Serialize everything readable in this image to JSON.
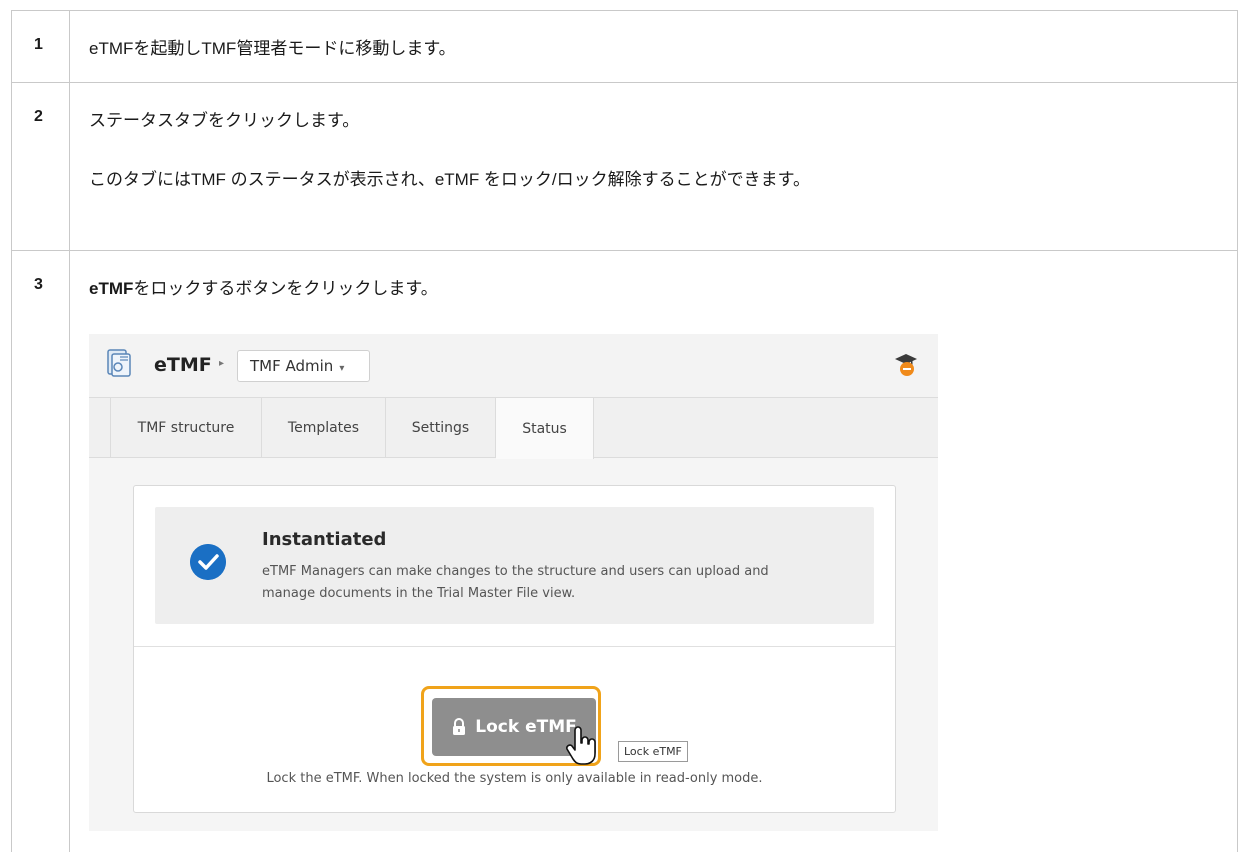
{
  "steps": [
    {
      "num": "1",
      "text": "eTMFを起動しTMF管理者モードに移動します。"
    },
    {
      "num": "2",
      "text": "ステータスタブをクリックします。",
      "note": "このタブにはTMF のステータスが表示され、eTMF をロック/ロック解除することができます。"
    },
    {
      "num": "3",
      "bold": "eTMF",
      "text": "をロックするボタンをクリックします。"
    }
  ],
  "app": {
    "name": "eTMF",
    "mode": "TMF Admin",
    "icon": "document-app-icon",
    "help_icon": "graduation-cap-icon"
  },
  "tabs": [
    {
      "label": "TMF structure"
    },
    {
      "label": "Templates"
    },
    {
      "label": "Settings"
    },
    {
      "label": "Status"
    }
  ],
  "status": {
    "title": "Instantiated",
    "description": "eTMF Managers can make changes to the structure and users can upload and manage documents in the Trial Master File view."
  },
  "lock": {
    "button_label": "Lock eTMF",
    "tooltip": "Lock eTMF",
    "hint": "Lock the eTMF. When locked the system is only available in read-only mode."
  },
  "colors": {
    "accent_blue": "#1a6fc4",
    "highlight_orange": "#f0a31a",
    "button_gray": "#8e8e8e"
  }
}
